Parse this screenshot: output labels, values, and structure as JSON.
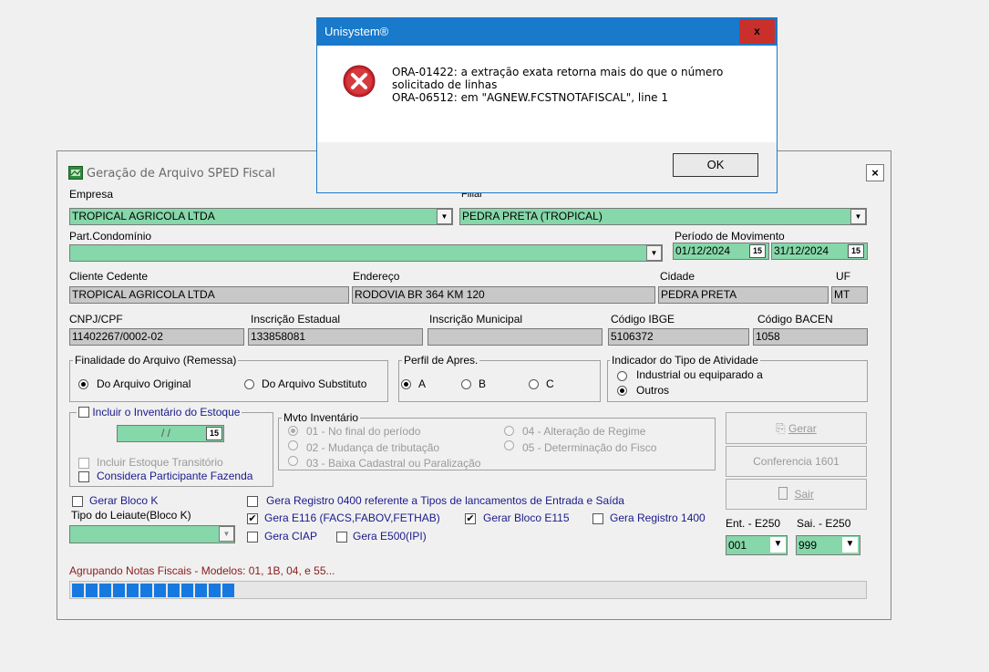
{
  "window": {
    "title": "Geração de Arquivo SPED Fiscal",
    "close": "×"
  },
  "empresa": {
    "label": "Empresa",
    "value": "TROPICAL AGRICOLA LTDA"
  },
  "filial": {
    "label": "Filial",
    "value": "PEDRA PRETA (TROPICAL)"
  },
  "part": {
    "label": "Part.Condomínio",
    "value": ""
  },
  "periodo": {
    "label": "Período de Movimento",
    "inicio": "01/12/2024",
    "fim": "31/12/2024",
    "cal_icon": "15"
  },
  "cliente": {
    "label": "Cliente Cedente",
    "value": "TROPICAL AGRICOLA LTDA"
  },
  "endereco": {
    "label": "Endereço",
    "value": "RODOVIA BR 364 KM 120"
  },
  "cidade": {
    "label": "Cidade",
    "value": "PEDRA PRETA"
  },
  "uf": {
    "label": "UF",
    "value": "MT"
  },
  "cnpj": {
    "label": "CNPJ/CPF",
    "value": "11402267/0002-02"
  },
  "ie": {
    "label": "Inscrição Estadual",
    "value": "133858081"
  },
  "im": {
    "label": "Inscrição Municipal",
    "value": ""
  },
  "ibge": {
    "label": "Código IBGE",
    "value": "5106372"
  },
  "bacen": {
    "label": "Código BACEN",
    "value": "1058"
  },
  "finalidade": {
    "label": "Finalidade do Arquivo (Remessa)",
    "opt1": "Do Arquivo Original",
    "opt2": "Do Arquivo Substituto",
    "selected": "opt1"
  },
  "perfil": {
    "label": "Perfil de Apres.",
    "a": "A",
    "b": "B",
    "c": "C",
    "selected": "A"
  },
  "atividade": {
    "label": "Indicador do Tipo de Atividade",
    "opt1": "Industrial ou equiparado a",
    "opt2": "Outros",
    "selected": "opt2"
  },
  "inventario": {
    "label": "Incluir o Inventário do Estoque",
    "date": " / /",
    "transitorio": "Incluir Estoque Transitório",
    "fazenda": "Considera Participante Fazenda"
  },
  "mvto": {
    "label": "Mvto Inventário",
    "o1": "01 - No final do período",
    "o2": "02 - Mudança de tributação",
    "o3": "03 - Baixa Cadastral ou Paralização",
    "o4": "04 - Alteração de Regime",
    "o5": "05 - Determinação do Fisco"
  },
  "buttons": {
    "gerar": "Gerar",
    "conferencia": "Conferencia 1601",
    "sair": "Sair"
  },
  "bloco_k": {
    "label": "Gerar Bloco K",
    "tipo_label": "Tipo do Leiaute(Bloco K)",
    "tipo_value": ""
  },
  "checks": {
    "reg0400": "Gera Registro 0400 referente a Tipos de lancamentos de Entrada e Saída",
    "e116": "Gera E116 (FACS,FABOV,FETHAB)",
    "e115": "Gerar Bloco E115",
    "reg1400": "Gera Registro 1400",
    "ciap": "Gera CIAP",
    "e500": "Gera E500(IPI)"
  },
  "e250": {
    "ent_label": "Ent. - E250",
    "ent_value": "001",
    "sai_label": "Sai. - E250",
    "sai_value": "999"
  },
  "status": {
    "text": "Agrupando Notas Fiscais  - Modelos: 01, 1B, 04, e 55...",
    "progress_blocks": 12
  },
  "dialog": {
    "title": "Unisystem®",
    "close": "x",
    "line1": "ORA-01422: a extração exata retorna mais do que o número",
    "line2": "solicitado de linhas",
    "line3": "ORA-06512: em \"AGNEW.FCSTNOTAFISCAL\", line 1",
    "ok": "OK",
    "icon": "error-icon"
  },
  "colors": {
    "field_green": "#86d7a9",
    "field_grey": "#c8c8c8",
    "status_red": "#8b1a1a",
    "progress_blue": "#1779e0",
    "dialog_title": "#1979ca"
  }
}
